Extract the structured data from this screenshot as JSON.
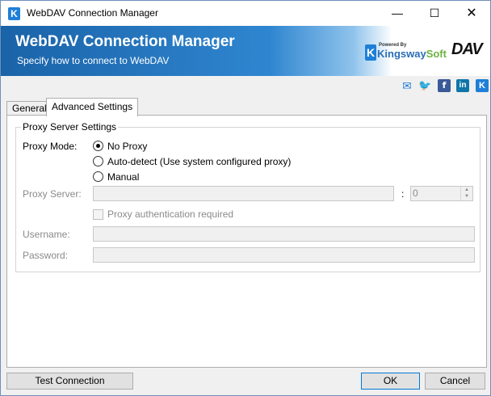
{
  "window": {
    "title": "WebDAV Connection Manager",
    "controls": {
      "minimize": "—",
      "maximize": "☐",
      "close": "✕"
    }
  },
  "banner": {
    "title": "WebDAV Connection Manager",
    "subtitle": "Specify how to connect to WebDAV",
    "kingsway_powered": "Powered By",
    "kingsway_name_a": "Kingsway",
    "kingsway_name_b": "Soft",
    "dav_logo": "DAV",
    "colors": {
      "start": "#1a63a8",
      "mid": "#2f86d0"
    }
  },
  "social": {
    "icons": [
      "mail-icon",
      "twitter-icon",
      "facebook-icon",
      "linkedin-icon",
      "kingswaysoft-icon"
    ],
    "fb": "f",
    "in": "in",
    "ks": "K"
  },
  "tabs": [
    {
      "label": "General",
      "active": false
    },
    {
      "label": "Advanced Settings",
      "active": true
    }
  ],
  "proxy": {
    "group_title": "Proxy Server Settings",
    "mode_label": "Proxy Mode:",
    "options": [
      {
        "label": "No Proxy",
        "selected": true
      },
      {
        "label": "Auto-detect (Use system configured proxy)",
        "selected": false
      },
      {
        "label": "Manual",
        "selected": false
      }
    ],
    "server_label": "Proxy Server:",
    "server_value": "",
    "port_separator": ":",
    "port_value": "0",
    "auth_label": "Proxy authentication required",
    "auth_checked": false,
    "username_label": "Username:",
    "username_value": "",
    "password_label": "Password:",
    "password_value": ""
  },
  "buttons": {
    "test": "Test Connection",
    "ok": "OK",
    "cancel": "Cancel"
  }
}
